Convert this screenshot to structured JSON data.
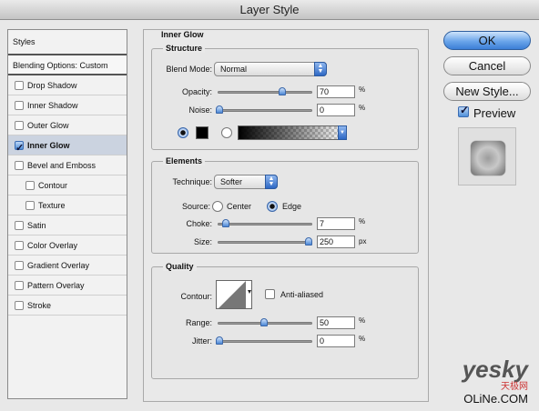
{
  "window": {
    "title": "Layer Style"
  },
  "sidebar": {
    "header": "Styles",
    "blending": "Blending Options: Custom",
    "items": [
      {
        "label": "Drop Shadow",
        "checked": false,
        "indent": false
      },
      {
        "label": "Inner Shadow",
        "checked": false,
        "indent": false
      },
      {
        "label": "Outer Glow",
        "checked": false,
        "indent": false
      },
      {
        "label": "Inner Glow",
        "checked": true,
        "indent": false
      },
      {
        "label": "Bevel and Emboss",
        "checked": false,
        "indent": false
      },
      {
        "label": "Contour",
        "checked": false,
        "indent": true
      },
      {
        "label": "Texture",
        "checked": false,
        "indent": true
      },
      {
        "label": "Satin",
        "checked": false,
        "indent": false
      },
      {
        "label": "Color Overlay",
        "checked": false,
        "indent": false
      },
      {
        "label": "Gradient Overlay",
        "checked": false,
        "indent": false
      },
      {
        "label": "Pattern Overlay",
        "checked": false,
        "indent": false
      },
      {
        "label": "Stroke",
        "checked": false,
        "indent": false
      }
    ]
  },
  "main": {
    "title": "Inner Glow",
    "structure": {
      "title": "Structure",
      "blend_mode_label": "Blend Mode:",
      "blend_mode_value": "Normal",
      "opacity_label": "Opacity:",
      "opacity_value": "70",
      "noise_label": "Noise:",
      "noise_value": "0",
      "unit_pct": "%"
    },
    "elements": {
      "title": "Elements",
      "technique_label": "Technique:",
      "technique_value": "Softer",
      "source_label": "Source:",
      "source_center": "Center",
      "source_edge": "Edge",
      "choke_label": "Choke:",
      "choke_value": "7",
      "size_label": "Size:",
      "size_value": "250",
      "unit_pct": "%",
      "unit_px": "px"
    },
    "quality": {
      "title": "Quality",
      "contour_label": "Contour:",
      "antialiased_label": "Anti-aliased",
      "range_label": "Range:",
      "range_value": "50",
      "jitter_label": "Jitter:",
      "jitter_value": "0",
      "unit_pct": "%"
    }
  },
  "buttons": {
    "ok": "OK",
    "cancel": "Cancel",
    "new_style": "New Style...",
    "preview": "Preview"
  },
  "watermark": {
    "brand": "yesky",
    "cn": "天极网",
    "site": "OLiNe.COM"
  }
}
